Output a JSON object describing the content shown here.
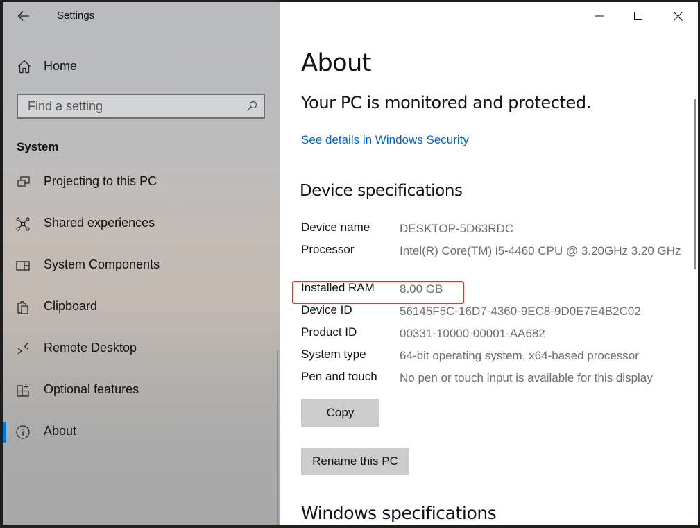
{
  "window": {
    "app_title": "Settings",
    "controls": {
      "minimize_icon": "minimize-icon",
      "maximize_icon": "maximize-icon",
      "close_icon": "close-icon"
    }
  },
  "sidebar": {
    "back_icon": "back-arrow-icon",
    "home": {
      "label": "Home",
      "icon": "home-icon"
    },
    "search": {
      "placeholder": "Find a setting",
      "value": "",
      "icon": "search-icon"
    },
    "section_label": "System",
    "items": [
      {
        "label": "Projecting to this PC",
        "icon": "projecting-icon",
        "active": false
      },
      {
        "label": "Shared experiences",
        "icon": "shared-experiences-icon",
        "active": false
      },
      {
        "label": "System Components",
        "icon": "system-components-icon",
        "active": false
      },
      {
        "label": "Clipboard",
        "icon": "clipboard-icon",
        "active": false
      },
      {
        "label": "Remote Desktop",
        "icon": "remote-desktop-icon",
        "active": false
      },
      {
        "label": "Optional features",
        "icon": "optional-features-icon",
        "active": false
      },
      {
        "label": "About",
        "icon": "info-icon",
        "active": true
      }
    ],
    "accent_color": "#0078d7"
  },
  "main": {
    "title": "About",
    "protection_status": "Your PC is monitored and protected.",
    "security_link": "See details in Windows Security",
    "device_specs_heading": "Device specifications",
    "specs": [
      {
        "key": "Device name",
        "value": "DESKTOP-5D63RDC"
      },
      {
        "key": "Processor",
        "value": "Intel(R) Core(TM) i5-4460  CPU @ 3.20GHz   3.20 GHz"
      },
      {
        "key": "Installed RAM",
        "value": "8.00 GB",
        "highlighted": true
      },
      {
        "key": "Device ID",
        "value": "56145F5C-16D7-4360-9EC8-9D0E7E4B2C02"
      },
      {
        "key": "Product ID",
        "value": "00331-10000-00001-AA682"
      },
      {
        "key": "System type",
        "value": "64-bit operating system, x64-based processor"
      },
      {
        "key": "Pen and touch",
        "value": "No pen or touch input is available for this display"
      }
    ],
    "copy_button": "Copy",
    "rename_button": "Rename this PC",
    "windows_specs_heading": "Windows specifications",
    "link_color": "#0067c0",
    "highlight_color": "#e8302a"
  }
}
